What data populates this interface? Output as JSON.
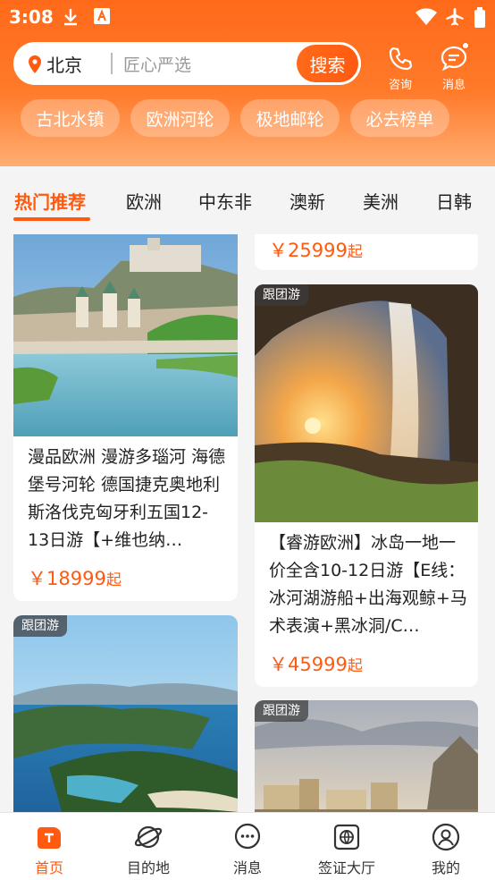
{
  "status_bar": {
    "time": "3:08"
  },
  "header": {
    "city": "北京",
    "search_placeholder": "匠心严选",
    "search_button": "搜索",
    "consult_label": "咨询",
    "message_label": "消息",
    "chips": [
      "古北水镇",
      "欧洲河轮",
      "极地邮轮",
      "必去榜单"
    ]
  },
  "tabs": [
    "热门推荐",
    "欧洲",
    "中东非",
    "澳新",
    "美洲",
    "日韩"
  ],
  "cards": {
    "top_right_partial": {
      "price": "￥25999",
      "price_unit": "起"
    },
    "left_1": {
      "title": "漫品欧洲 漫游多瑙河 海德堡号河轮 德国捷克奥地利斯洛伐克匈牙利五国12-13日游【+维也纳…",
      "price": "￥18999",
      "price_unit": "起"
    },
    "right_1": {
      "tag": "跟团游",
      "title": "【睿游欧洲】冰岛一地一价全含10-12日游【E线：冰河湖游船+出海观鲸+马术表演+黑冰洞/C…",
      "price": "￥45999",
      "price_unit": "起"
    },
    "left_2": {
      "tag": "跟团游"
    },
    "right_2": {
      "tag": "跟团游"
    }
  },
  "bottom_nav": [
    {
      "label": "首页",
      "icon": "home-icon",
      "active": true
    },
    {
      "label": "目的地",
      "icon": "planet-icon",
      "active": false
    },
    {
      "label": "消息",
      "icon": "chat-icon",
      "active": false
    },
    {
      "label": "签证大厅",
      "icon": "visa-icon",
      "active": false
    },
    {
      "label": "我的",
      "icon": "user-icon",
      "active": false
    }
  ],
  "colors": {
    "accent": "#ff5a10",
    "header": "#ff6a1a"
  }
}
